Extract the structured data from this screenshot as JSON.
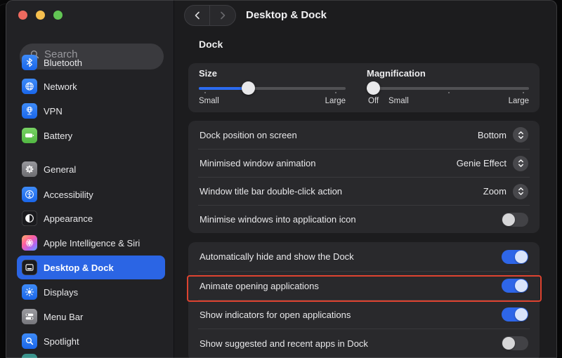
{
  "window": {
    "traffic_lights": [
      "close",
      "minimize",
      "zoom"
    ]
  },
  "sidebar": {
    "search": {
      "placeholder": "Search"
    },
    "items": [
      {
        "label": "Bluetooth",
        "icon": "bluetooth-icon",
        "color": "#2d7cf6"
      },
      {
        "label": "Network",
        "icon": "globe-icon",
        "color": "#2d7cf6"
      },
      {
        "label": "VPN",
        "icon": "vpn-globe-icon",
        "color": "#2d7cf6"
      },
      {
        "label": "Battery",
        "icon": "battery-icon",
        "color": "#62c04f"
      },
      {
        "label": "General",
        "icon": "gear-icon",
        "color": "#8e8e93"
      },
      {
        "label": "Accessibility",
        "icon": "accessibility-icon",
        "color": "#2d7cf6"
      },
      {
        "label": "Appearance",
        "icon": "appearance-contrast-icon",
        "color": "#1b1b1e"
      },
      {
        "label": "Apple Intelligence & Siri",
        "icon": "siri-flower-icon",
        "color": "gradient"
      },
      {
        "label": "Desktop & Dock",
        "icon": "desktop-dock-icon",
        "color": "#1b1b1e",
        "selected": true
      },
      {
        "label": "Displays",
        "icon": "sun-icon",
        "color": "#2d7cf6"
      },
      {
        "label": "Menu Bar",
        "icon": "menu-bar-switches-icon",
        "color": "#8e8e93"
      },
      {
        "label": "Spotlight",
        "icon": "magnifier-icon",
        "color": "#2d7cf6"
      }
    ]
  },
  "header": {
    "title": "Desktop & Dock"
  },
  "content": {
    "section_title": "Dock",
    "sliders": {
      "size": {
        "label": "Size",
        "min_label": "Small",
        "max_label": "Large",
        "value_pct": 32
      },
      "magnification": {
        "label": "Magnification",
        "off_label": "Off",
        "min_label": "Small",
        "max_label": "Large",
        "value_pct": 0
      }
    },
    "dropdown_rows": [
      {
        "label": "Dock position on screen",
        "value": "Bottom"
      },
      {
        "label": "Minimised window animation",
        "value": "Genie Effect"
      },
      {
        "label": "Window title bar double-click action",
        "value": "Zoom"
      }
    ],
    "toggle_rows_card2": [
      {
        "label": "Minimise windows into application icon",
        "state": "off"
      }
    ],
    "toggle_rows_card3": [
      {
        "label": "Automatically hide and show the Dock",
        "state": "on"
      },
      {
        "label": "Animate opening applications",
        "state": "on",
        "highlighted": true
      },
      {
        "label": "Show indicators for open applications",
        "state": "on"
      },
      {
        "label": "Show suggested and recent apps in Dock",
        "state": "off"
      }
    ],
    "annotation": {
      "color": "#de4330",
      "target": "Animate opening applications"
    }
  },
  "colors": {
    "accent_blue": "#2b65e4",
    "toggle_on": "#2e66e8",
    "card_bg": "#29292c",
    "sidebar_bg": "#222225",
    "content_bg": "#1c1c1e",
    "annotation_red": "#de4330"
  }
}
